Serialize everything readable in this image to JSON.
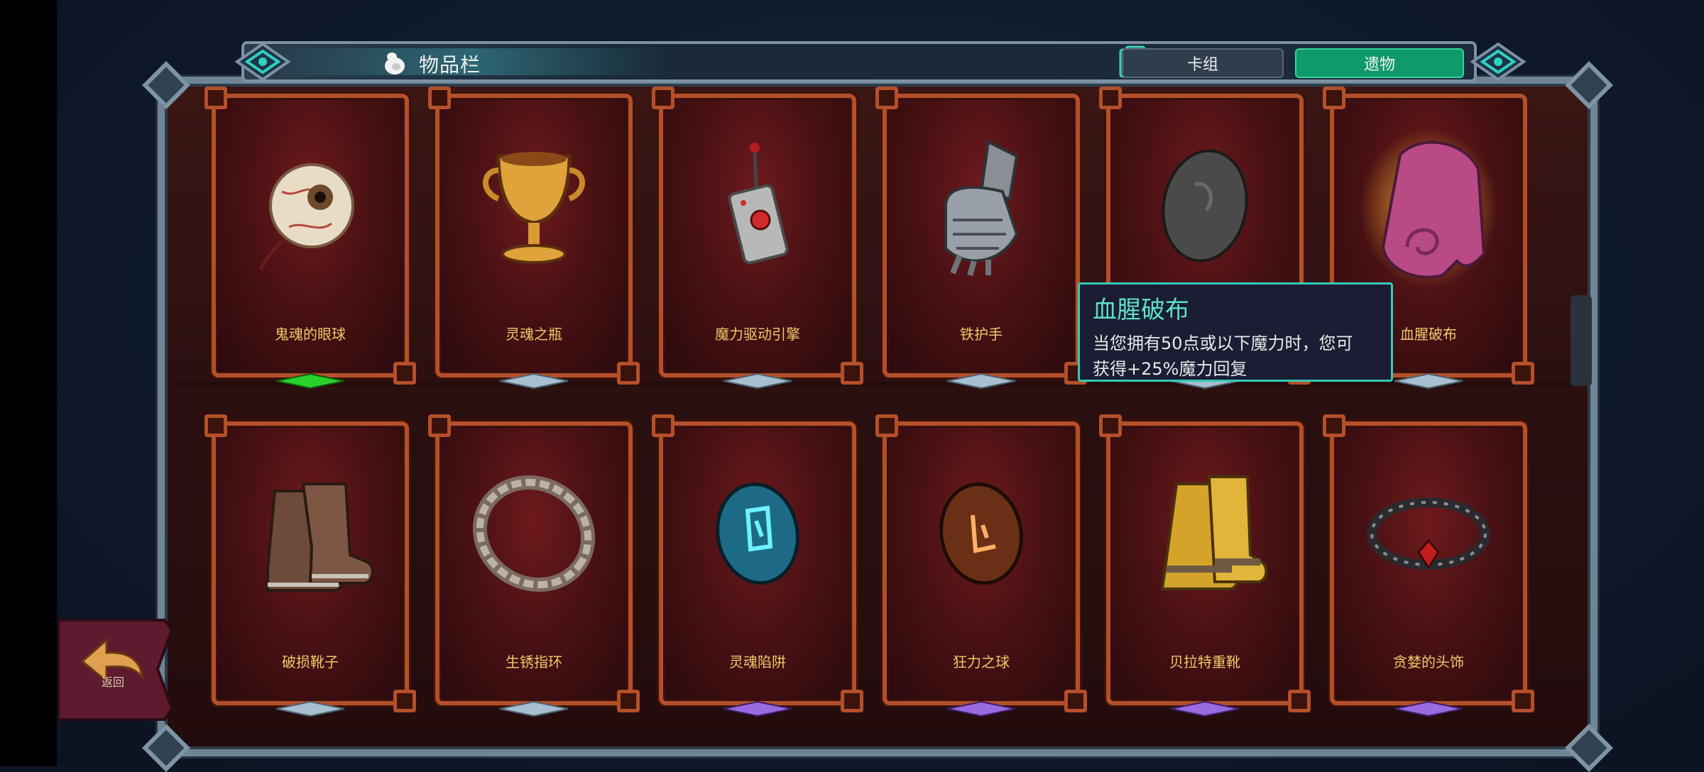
{
  "header": {
    "title": "物品栏",
    "tabs": [
      {
        "label": "卡组",
        "active": false
      },
      {
        "label": "遗物",
        "active": true
      }
    ]
  },
  "colors": {
    "accent_teal": "#35c9b6",
    "tab_active": "#0f9a6a",
    "card_border": "#b3502a",
    "label_gold": "#f2c76a",
    "gem_green": "#2ad12a",
    "gem_silver": "#a8bfd0",
    "gem_purple": "#9a6ae0"
  },
  "items": [
    {
      "name": "鬼魂的眼球",
      "icon": "eyeball-icon",
      "rarity": "green"
    },
    {
      "name": "灵魂之瓶",
      "icon": "golden-chalice-icon",
      "rarity": "silver"
    },
    {
      "name": "魔力驱动引擎",
      "icon": "remote-detonator-icon",
      "rarity": "silver"
    },
    {
      "name": "铁护手",
      "icon": "iron-gauntlet-icon",
      "rarity": "silver"
    },
    {
      "name": "",
      "icon": "grey-stone-icon",
      "rarity": "silver"
    },
    {
      "name": "血腥破布",
      "icon": "bloody-rag-icon",
      "rarity": "silver"
    },
    {
      "name": "破损靴子",
      "icon": "worn-boots-icon",
      "rarity": "silver"
    },
    {
      "name": "生锈指环",
      "icon": "rusty-ring-icon",
      "rarity": "silver"
    },
    {
      "name": "灵魂陷阱",
      "icon": "blue-rune-stone-icon",
      "rarity": "purple"
    },
    {
      "name": "狂力之球",
      "icon": "orange-rune-stone-icon",
      "rarity": "purple"
    },
    {
      "name": "贝拉特重靴",
      "icon": "golden-boots-icon",
      "rarity": "purple"
    },
    {
      "name": "贪婪的头饰",
      "icon": "thorn-circlet-icon",
      "rarity": "purple"
    }
  ],
  "tooltip": {
    "title": "血腥破布",
    "desc_line1": "当您拥有50点或以下魔力时，您可",
    "desc_line2": "获得+25%魔力回复"
  },
  "back_button": {
    "label": "返回",
    "icon": "back-arrow-icon"
  }
}
